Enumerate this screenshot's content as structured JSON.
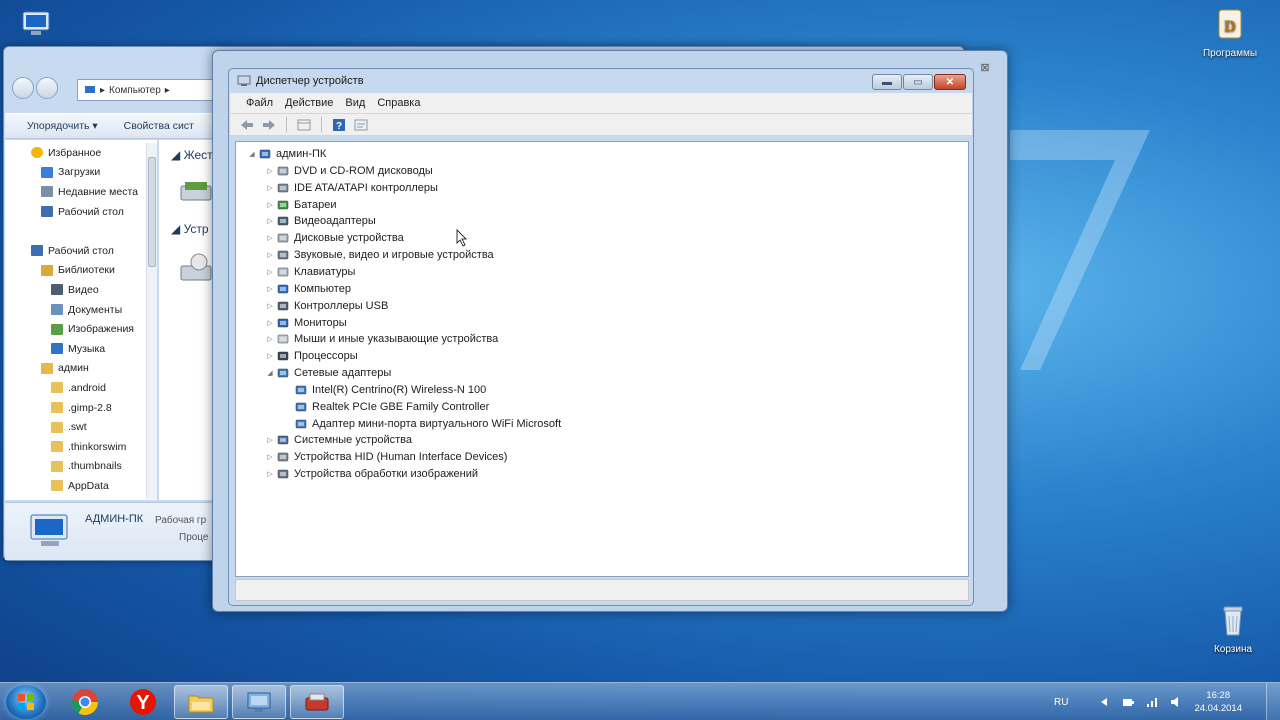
{
  "desktop": {
    "icons": [
      {
        "label": "",
        "icon": "computer-icon"
      },
      {
        "label": "Программы",
        "icon": "programs-icon"
      },
      {
        "label": "Корзина",
        "icon": "recycle-bin-icon"
      }
    ]
  },
  "explorer": {
    "address": "Компьютер",
    "toolbar": {
      "organize": "Упорядочить ▾",
      "properties": "Свойства сист"
    },
    "sidebar": [
      {
        "label": "Избранное",
        "icon": "star-icon",
        "indent": 0
      },
      {
        "label": "Загрузки",
        "icon": "downloads-icon",
        "indent": 1
      },
      {
        "label": "Недавние места",
        "icon": "recent-places-icon",
        "indent": 1
      },
      {
        "label": "Рабочий стол",
        "icon": "desktop-folder-icon",
        "indent": 1
      },
      {
        "label": "",
        "icon": "",
        "indent": 0
      },
      {
        "label": "Рабочий стол",
        "icon": "desktop-folder-icon",
        "indent": 0
      },
      {
        "label": "Библиотеки",
        "icon": "libraries-icon",
        "indent": 1
      },
      {
        "label": "Видео",
        "icon": "video-icon",
        "indent": 2
      },
      {
        "label": "Документы",
        "icon": "documents-icon",
        "indent": 2
      },
      {
        "label": "Изображения",
        "icon": "pictures-icon",
        "indent": 2
      },
      {
        "label": "Музыка",
        "icon": "music-icon",
        "indent": 2
      },
      {
        "label": "админ",
        "icon": "user-folder-icon",
        "indent": 1
      },
      {
        "label": ".android",
        "icon": "folder-icon",
        "indent": 2
      },
      {
        "label": ".gimp-2.8",
        "icon": "folder-icon",
        "indent": 2
      },
      {
        "label": ".swt",
        "icon": "folder-icon",
        "indent": 2
      },
      {
        "label": ".thinkorswim",
        "icon": "folder-icon",
        "indent": 2
      },
      {
        "label": ".thumbnails",
        "icon": "folder-icon",
        "indent": 2
      },
      {
        "label": "AppData",
        "icon": "folder-icon",
        "indent": 2
      }
    ],
    "content_headers": [
      "Жест",
      "Устр"
    ],
    "status": {
      "name": "АДМИН-ПК",
      "workgroup": "Рабочая гр",
      "processor": "Проце"
    }
  },
  "device_manager": {
    "title": "Диспетчер устройств",
    "menu": [
      "Файл",
      "Действие",
      "Вид",
      "Справка"
    ],
    "tree": [
      {
        "label": "админ-ПК",
        "icon": "computer-icon",
        "level": 0,
        "toggle": "◢"
      },
      {
        "label": "DVD и CD-ROM дисководы",
        "icon": "dvd-drive-icon",
        "level": 1,
        "toggle": "▷"
      },
      {
        "label": "IDE ATA/ATAPI контроллеры",
        "icon": "ide-controller-icon",
        "level": 1,
        "toggle": "▷"
      },
      {
        "label": "Батареи",
        "icon": "battery-icon",
        "level": 1,
        "toggle": "▷"
      },
      {
        "label": "Видеоадаптеры",
        "icon": "display-adapter-icon",
        "level": 1,
        "toggle": "▷"
      },
      {
        "label": "Дисковые устройства",
        "icon": "disk-drive-icon",
        "level": 1,
        "toggle": "▷"
      },
      {
        "label": "Звуковые, видео и игровые устройства",
        "icon": "sound-icon",
        "level": 1,
        "toggle": "▷"
      },
      {
        "label": "Клавиатуры",
        "icon": "keyboard-icon",
        "level": 1,
        "toggle": "▷"
      },
      {
        "label": "Компьютер",
        "icon": "computer-icon",
        "level": 1,
        "toggle": "▷"
      },
      {
        "label": "Контроллеры USB",
        "icon": "usb-icon",
        "level": 1,
        "toggle": "▷"
      },
      {
        "label": "Мониторы",
        "icon": "monitor-icon",
        "level": 1,
        "toggle": "▷"
      },
      {
        "label": "Мыши и иные указывающие устройства",
        "icon": "mouse-icon",
        "level": 1,
        "toggle": "▷"
      },
      {
        "label": "Процессоры",
        "icon": "processor-icon",
        "level": 1,
        "toggle": "▷"
      },
      {
        "label": "Сетевые адаптеры",
        "icon": "network-adapter-icon",
        "level": 1,
        "toggle": "◢"
      },
      {
        "label": "Intel(R) Centrino(R) Wireless-N 100",
        "icon": "network-adapter-icon",
        "level": 2,
        "toggle": ""
      },
      {
        "label": "Realtek PCIe GBE Family Controller",
        "icon": "network-adapter-icon",
        "level": 2,
        "toggle": ""
      },
      {
        "label": "Адаптер мини-порта виртуального WiFi Microsoft",
        "icon": "network-adapter-icon",
        "level": 2,
        "toggle": ""
      },
      {
        "label": "Системные устройства",
        "icon": "system-devices-icon",
        "level": 1,
        "toggle": "▷"
      },
      {
        "label": "Устройства HID (Human Interface Devices)",
        "icon": "hid-icon",
        "level": 1,
        "toggle": "▷"
      },
      {
        "label": "Устройства обработки изображений",
        "icon": "imaging-icon",
        "level": 1,
        "toggle": "▷"
      }
    ]
  },
  "taskbar": {
    "pinned": [
      "start-orb-icon",
      "chrome-icon",
      "yandex-icon",
      "explorer-icon",
      "control-panel-icon",
      "device-manager-icon"
    ],
    "language": "RU",
    "time": "16:28",
    "date": "24.04.2014"
  }
}
